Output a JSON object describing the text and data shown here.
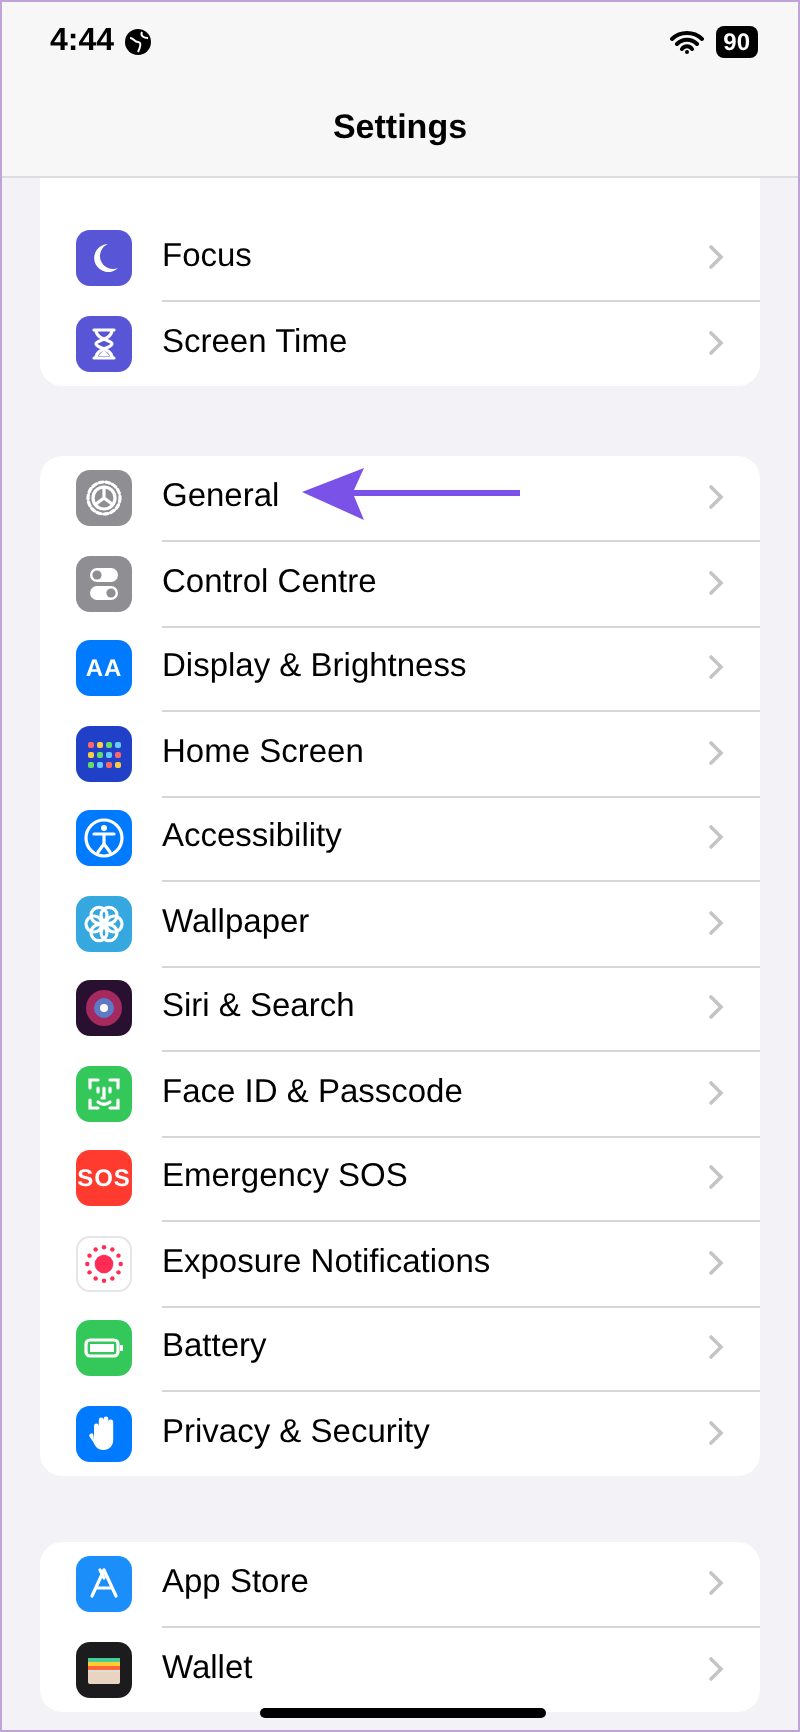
{
  "status_bar": {
    "time": "4:44",
    "battery": "90"
  },
  "title": "Settings",
  "groups": [
    {
      "rows": [
        {
          "label": "Focus",
          "color": "#5856d6"
        },
        {
          "label": "Screen Time",
          "color": "#5856d6"
        }
      ]
    },
    {
      "rows": [
        {
          "label": "General",
          "color": "#8e8e93"
        },
        {
          "label": "Control Centre",
          "color": "#8e8e93"
        },
        {
          "label": "Display & Brightness",
          "color": "#007aff",
          "icon_text": "AA"
        },
        {
          "label": "Home Screen",
          "color": "#2140c8"
        },
        {
          "label": "Accessibility",
          "color": "#007aff"
        },
        {
          "label": "Wallpaper",
          "color": "#36a8e0"
        },
        {
          "label": "Siri & Search",
          "color": "#2a1030"
        },
        {
          "label": "Face ID & Passcode",
          "color": "#34c759"
        },
        {
          "label": "Emergency SOS",
          "color": "#ff3b30",
          "icon_text": "SOS"
        },
        {
          "label": "Exposure Notifications",
          "color": "#ffffff"
        },
        {
          "label": "Battery",
          "color": "#34c759"
        },
        {
          "label": "Privacy & Security",
          "color": "#007aff"
        }
      ]
    },
    {
      "rows": [
        {
          "label": "App Store",
          "color": "#1c8ef9"
        },
        {
          "label": "Wallet",
          "color": "#1c1c1e"
        }
      ]
    }
  ]
}
